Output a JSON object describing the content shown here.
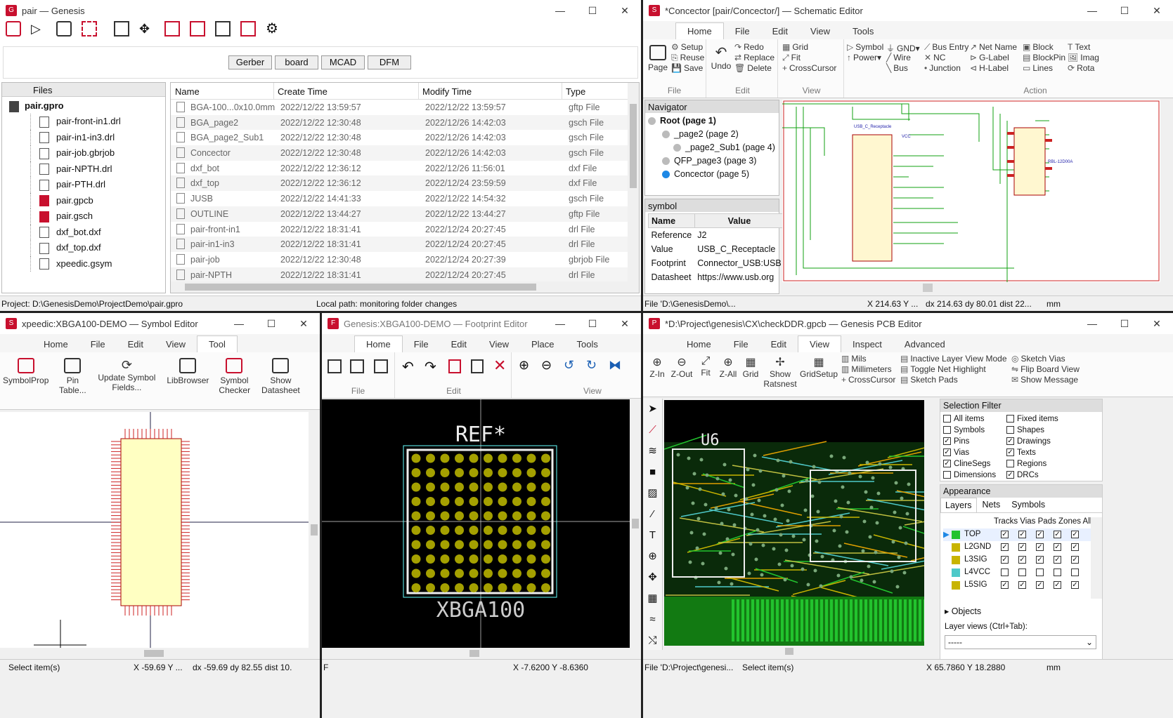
{
  "genesis": {
    "title": "pair — Genesis",
    "tabs": [
      "Gerber",
      "board",
      "MCAD",
      "DFM"
    ],
    "tree_header": "Files",
    "project": "pair.gpro",
    "tree": [
      "pair-front-in1.drl",
      "pair-in1-in3.drl",
      "pair-job.gbrjob",
      "pair-NPTH.drl",
      "pair-PTH.drl",
      "pair.gpcb",
      "pair.gsch",
      "dxf_bot.dxf",
      "dxf_top.dxf",
      "xpeedic.gsym"
    ],
    "cols": [
      "Name",
      "Create Time",
      "Modify Time",
      "Type"
    ],
    "rows": [
      [
        "BGA-100...0x10.0mm",
        "2022/12/22 13:59:57",
        "2022/12/22 13:59:57",
        "gftp File"
      ],
      [
        "BGA_page2",
        "2022/12/22 12:30:48",
        "2022/12/26 14:42:03",
        "gsch File"
      ],
      [
        "BGA_page2_Sub1",
        "2022/12/22 12:30:48",
        "2022/12/26 14:42:03",
        "gsch File"
      ],
      [
        "Concector",
        "2022/12/22 12:30:48",
        "2022/12/26 14:42:03",
        "gsch File"
      ],
      [
        "dxf_bot",
        "2022/12/22 12:36:12",
        "2022/12/26 11:56:01",
        "dxf File"
      ],
      [
        "dxf_top",
        "2022/12/22 12:36:12",
        "2022/12/24 23:59:59",
        "dxf File"
      ],
      [
        "JUSB",
        "2022/12/22 14:41:33",
        "2022/12/22 14:54:32",
        "gsch File"
      ],
      [
        "OUTLINE",
        "2022/12/22 13:44:27",
        "2022/12/22 13:44:27",
        "gftp File"
      ],
      [
        "pair-front-in1",
        "2022/12/22 18:31:41",
        "2022/12/24 20:27:45",
        "drl File"
      ],
      [
        "pair-in1-in3",
        "2022/12/22 18:31:41",
        "2022/12/24 20:27:45",
        "drl File"
      ],
      [
        "pair-job",
        "2022/12/22 12:30:48",
        "2022/12/24 20:27:39",
        "gbrjob File"
      ],
      [
        "pair-NPTH",
        "2022/12/22 18:31:41",
        "2022/12/24 20:27:45",
        "drl File"
      ]
    ],
    "status_project": "Project: D:\\GenesisDemo\\ProjectDemo\\pair.gpro",
    "status_local": "Local path: monitoring folder changes"
  },
  "sch": {
    "title": "*Concector [pair/Concector/] — Schematic Editor",
    "tabs": [
      "Home",
      "File",
      "Edit",
      "View",
      "Tools"
    ],
    "page": "Page",
    "setup": "Setup",
    "reuse": "Reuse",
    "save": "Save",
    "undo": "Undo",
    "redo": "Redo",
    "replace": "Replace",
    "delete": "Delete",
    "grid": "Grid",
    "fit": "Fit",
    "crosscursor": "CrossCursor",
    "symbol": "Symbol",
    "gnd": "GND▾",
    "bus_entry": "Bus Entry",
    "net_name": "Net Name",
    "block": "Block",
    "text": "Text",
    "power": "Power▾",
    "wire": "Wire",
    "nc": "NC",
    "g_label": "G-Label",
    "blockpin": "BlockPin",
    "imag": "Imag",
    "bus": "Bus",
    "junction": "Junction",
    "h_label": "H-Label",
    "lines": "Lines",
    "rota": "Rota",
    "grp_file": "File",
    "grp_edit": "Edit",
    "grp_view": "View",
    "grp_action": "Action",
    "navigator": "Navigator",
    "nav": [
      "Root (page 1)",
      "_page2 (page 2)",
      "_page2_Sub1 (page 4)",
      "QFP_page3 (page 3)",
      "Concector (page 5)"
    ],
    "symbol_hdr": "symbol",
    "prop_cols": [
      "Name",
      "Value"
    ],
    "props": [
      [
        "Reference",
        "J2"
      ],
      [
        "Value",
        "USB_C_Receptacle"
      ],
      [
        "Footprint",
        "Connector_USB:USB"
      ],
      [
        "Datasheet",
        "https://www.usb.org"
      ]
    ],
    "status": {
      "file": "File 'D:\\GenesisDemo\\...",
      "xy": "X 214.63  Y ...",
      "dxy": "dx 214.63  dy 80.01  dist 22...",
      "unit": "mm"
    }
  },
  "symed": {
    "title": "xpeedic:XBGA100-DEMO — Symbol Editor",
    "tabs": [
      "Home",
      "File",
      "Edit",
      "View",
      "Tool"
    ],
    "tools": [
      "SymbolProp",
      "Pin Table...",
      "Update Symbol Fields...",
      "LibBrowser",
      "Symbol Checker",
      "Show Datasheet"
    ],
    "status": {
      "sel": "Select item(s)",
      "xy": "X -59.69  Y ...",
      "dxy": "dx -59.69  dy 82.55  dist 10."
    }
  },
  "fped": {
    "title": "Genesis:XBGA100-DEMO — Footprint Editor",
    "tabs": [
      "Home",
      "File",
      "Edit",
      "View",
      "Place",
      "Tools"
    ],
    "grp_file": "File",
    "grp_edit": "Edit",
    "grp_view": "View",
    "ref": "REF*",
    "val": "XBGA100",
    "status": {
      "f": "F",
      "xy": "X -7.6200  Y -8.6360"
    }
  },
  "pcb": {
    "title": "*D:\\Project\\genesis\\CX\\checkDDR.gpcb — Genesis PCB Editor",
    "tabs": [
      "Home",
      "File",
      "Edit",
      "View",
      "Inspect",
      "Advanced"
    ],
    "zin": "Z-In",
    "zout": "Z-Out",
    "fit": "Fit",
    "zall": "Z-All",
    "grid": "Grid",
    "show": "Show",
    "ratsnest": "Ratsnest",
    "gridsetup": "GridSetup",
    "mils": "Mils",
    "mm": "Millimeters",
    "cc": "CrossCursor",
    "ilvm": "Inactive Layer View Mode",
    "tnh": "Toggle Net Highlight",
    "sp": "Sketch Pads",
    "sv": "Sketch Vias",
    "fbv": "Flip Board View",
    "sm": "Show Message",
    "selfilter": "Selection Filter",
    "filters": [
      [
        "All items",
        false
      ],
      [
        "Fixed items",
        false
      ],
      [
        "Symbols",
        false
      ],
      [
        "Shapes",
        false
      ],
      [
        "Pins",
        true
      ],
      [
        "Drawings",
        true
      ],
      [
        "Vias",
        true
      ],
      [
        "Texts",
        true
      ],
      [
        "ClineSegs",
        true
      ],
      [
        "Regions",
        false
      ],
      [
        "Dimensions",
        false
      ],
      [
        "DRCs",
        true
      ]
    ],
    "appearance": "Appearance",
    "app_tabs": [
      "Layers",
      "Nets",
      "Symbols"
    ],
    "layer_cols": "Tracks Vias Pads Zones All",
    "layers": [
      {
        "name": "TOP",
        "color": "#22c32e"
      },
      {
        "name": "L2GND",
        "color": "#c8b400"
      },
      {
        "name": "L3SIG",
        "color": "#c8b400"
      },
      {
        "name": "L4VCC",
        "color": "#4ec9c9"
      },
      {
        "name": "L5SIG",
        "color": "#c8b400"
      }
    ],
    "objects": "Objects",
    "layer_views": "Layer views (Ctrl+Tab):",
    "lv_value": "-----",
    "u6": "U6",
    "status": {
      "file": "File 'D:\\Project\\genesi...",
      "sel": "Select item(s)",
      "xy": "X 65.7860  Y 18.2880",
      "unit": "mm"
    }
  }
}
